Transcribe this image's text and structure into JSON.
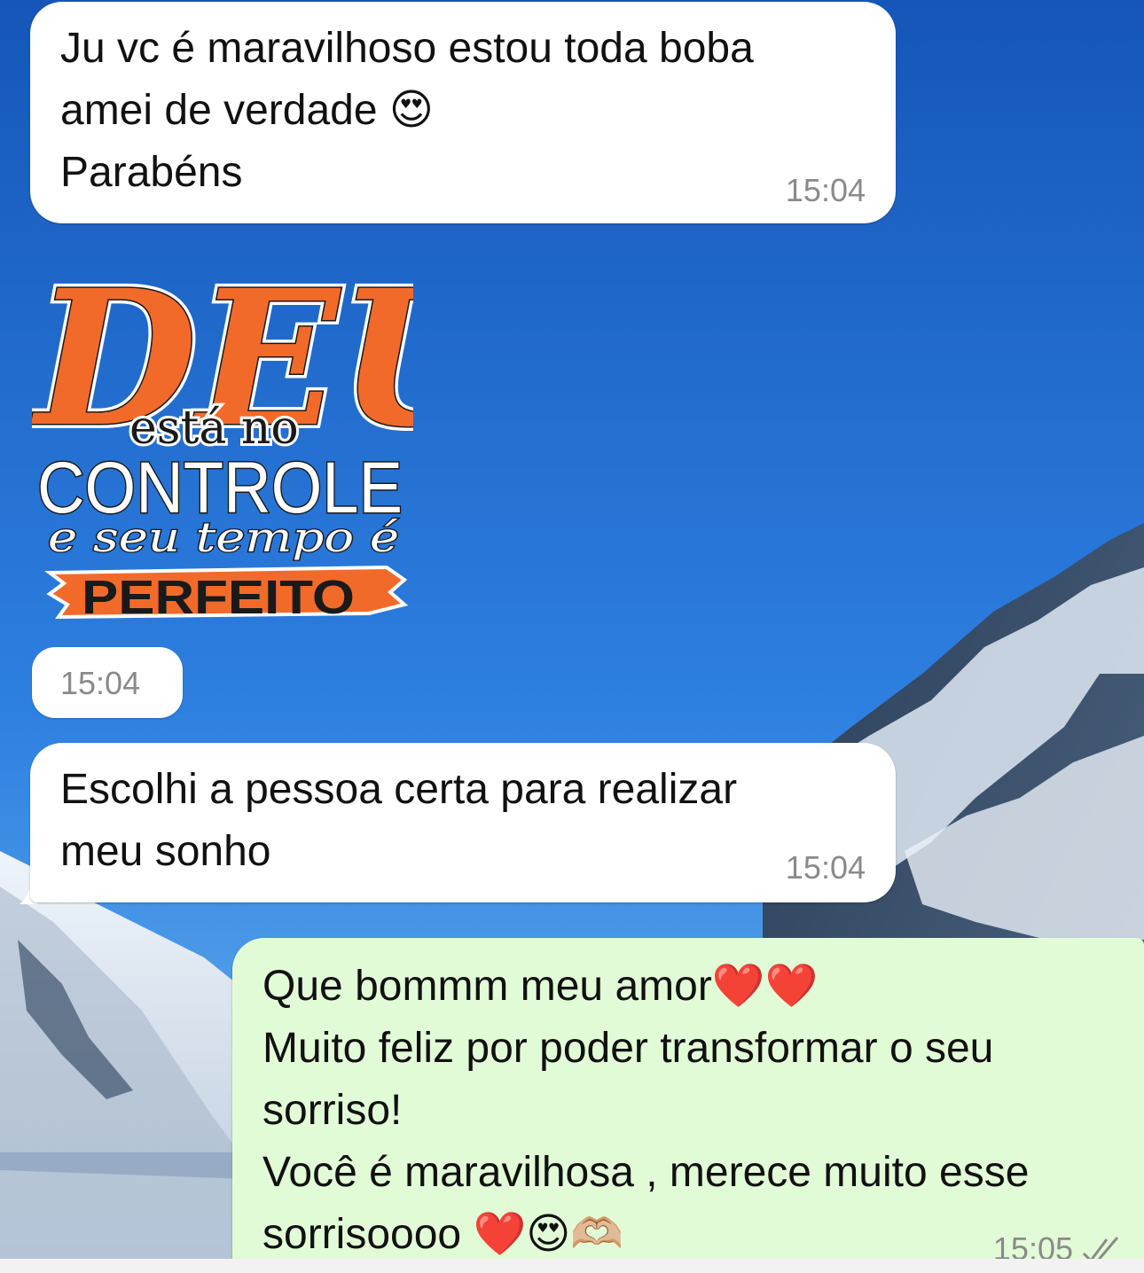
{
  "chat": {
    "messages": [
      {
        "direction": "in",
        "lines": [
          "Ju vc é maravilhoso estou toda boba",
          "amei de verdade 😍",
          "Parabéns"
        ],
        "time": "15:04"
      },
      {
        "direction": "in",
        "type": "sticker",
        "sticker_text": {
          "line1": "DEUS",
          "line2": "está no",
          "line3": "CONTROLE",
          "line4": "e seu tempo é",
          "line5": "PERFEITO"
        },
        "time": "15:04"
      },
      {
        "direction": "in",
        "lines": [
          "Escolhi a pessoa certa para realizar",
          "meu sonho"
        ],
        "time": "15:04"
      },
      {
        "direction": "out",
        "lines": [
          "Que bommm meu amor❤️❤️",
          "Muito feliz por poder transformar o seu",
          "sorriso!",
          "Você é maravilhosa , merece muito esse",
          "sorrisoooo ❤️😍🫶🏼"
        ],
        "time": "15:05",
        "status": "read-double-check"
      }
    ]
  },
  "colors": {
    "incoming_bubble": "#ffffff",
    "outgoing_bubble": "#e2fbd7",
    "timestamp": "#8a8a8a",
    "sky": "#1f66c8",
    "sticker_orange": "#f26a2a"
  },
  "icons": [
    "double-check-icon",
    "heart-eyes-emoji",
    "red-heart-emoji",
    "heart-hands-emoji"
  ]
}
